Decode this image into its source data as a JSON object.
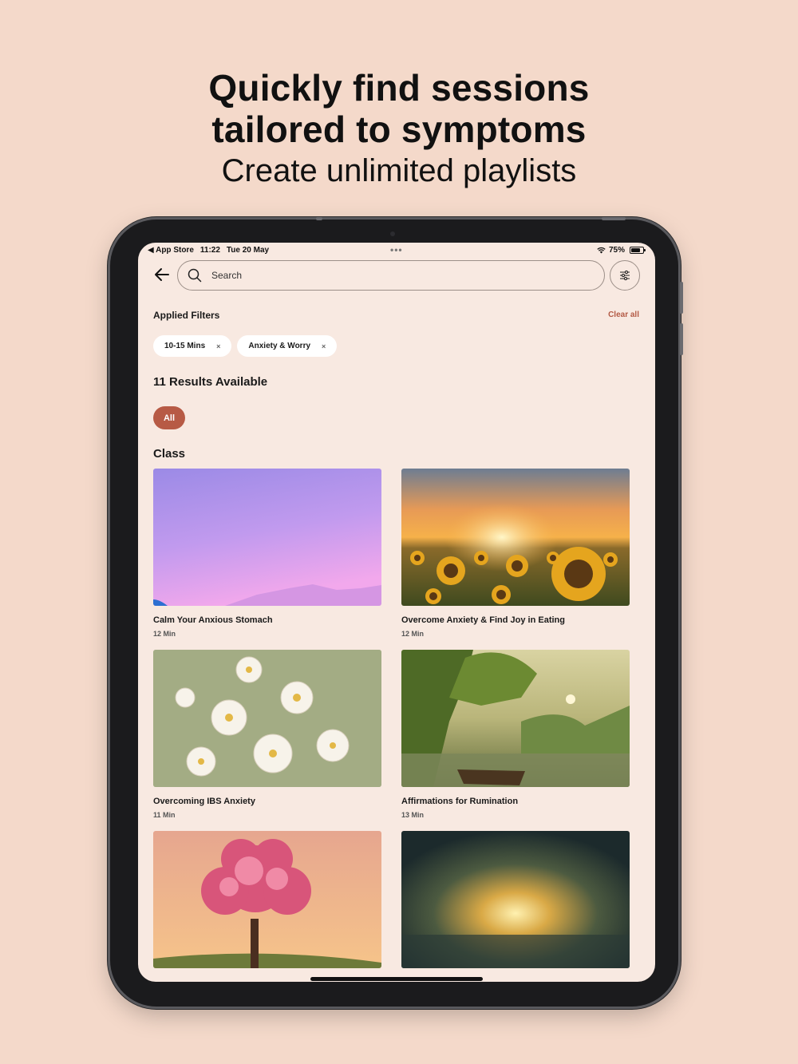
{
  "headline": {
    "line1": "Quickly find sessions",
    "line2": "tailored to symptoms",
    "line3": "Create unlimited playlists"
  },
  "status_bar": {
    "carrier": "◀ App Store",
    "time": "11:22",
    "date": "Tue 20 May",
    "battery_pct_label": "75%",
    "battery_level": 0.75
  },
  "search": {
    "placeholder": "Search"
  },
  "filters": {
    "label": "Applied Filters",
    "clear_label": "Clear all",
    "chips": [
      {
        "label": "10-15 Mins",
        "remove": "×"
      },
      {
        "label": "Anxiety & Worry",
        "remove": "×"
      }
    ]
  },
  "results": {
    "label": "11 Results Available"
  },
  "category_filter": {
    "label": "All"
  },
  "section": {
    "title": "Class"
  },
  "cards": [
    {
      "title": "Calm Your Anxious Stomach",
      "duration": "12 Min"
    },
    {
      "title": "Overcome Anxiety & Find Joy in Eating",
      "duration": "12 Min"
    },
    {
      "title": "Overcoming IBS Anxiety",
      "duration": "11 Min"
    },
    {
      "title": "Affirmations for Rumination",
      "duration": "13 Min"
    },
    {
      "title": "",
      "duration": ""
    },
    {
      "title": "",
      "duration": ""
    }
  ],
  "colors": {
    "background": "#f4d9ca",
    "screen": "#f8e9e1",
    "accent": "#b75a45"
  },
  "icons": {
    "back": "arrow-left-icon",
    "search": "magnifier-icon",
    "filter": "sliders-icon",
    "wifi": "wifi-icon",
    "battery": "battery-icon"
  }
}
